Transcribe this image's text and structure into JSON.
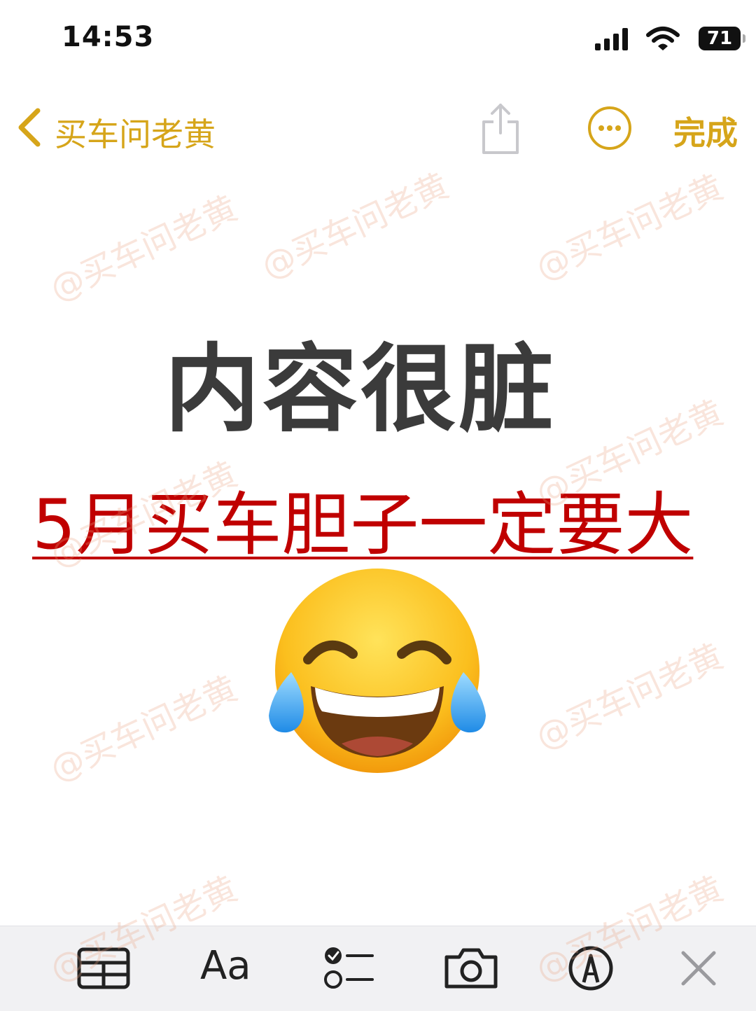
{
  "status_bar": {
    "time": "14:53",
    "battery": "71",
    "signal_icon": "cellular-signal-icon",
    "wifi_icon": "wifi-icon"
  },
  "nav": {
    "back_label": "买车问老黄",
    "done_label": "完成",
    "share_icon": "share-icon",
    "more_icon": "more-options-icon",
    "accent_color": "#d6a51a"
  },
  "note": {
    "title": "内容很脏",
    "subtitle": "5月买车胆子一定要大",
    "subtitle_color": "#c00000",
    "emoji": "face-with-tears-of-joy"
  },
  "watermark_text": "@买车问老黄",
  "toolbar": {
    "format_label": "Aa",
    "icons": [
      "table-icon",
      "format-icon",
      "checklist-icon",
      "camera-icon",
      "markup-pen-icon",
      "close-icon"
    ]
  }
}
